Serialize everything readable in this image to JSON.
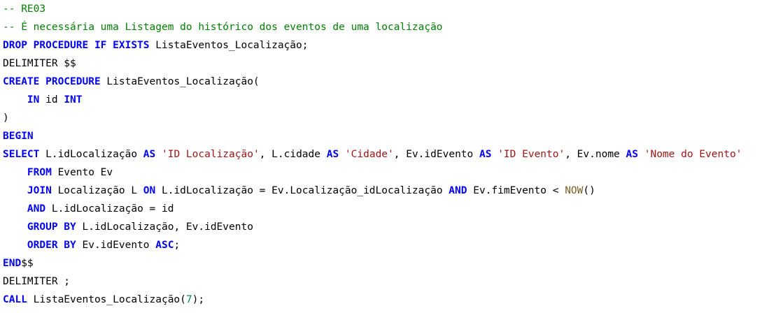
{
  "colors": {
    "background": "#ffffff",
    "keyword": "#0000ff",
    "comment": "#008000",
    "string": "#a31515",
    "number": "#098658",
    "function": "#795e26",
    "text": "#000000"
  },
  "lines": [
    [
      {
        "t": "comment",
        "v": "-- RE03"
      }
    ],
    [
      {
        "t": "comment",
        "v": "-- É necessária uma Listagem do histórico dos eventos de uma localização"
      }
    ],
    [
      {
        "t": "kw",
        "v": "DROP PROCEDURE IF EXISTS"
      },
      {
        "t": "text",
        "v": " ListaEventos_Localização;"
      }
    ],
    [
      {
        "t": "text",
        "v": "DELIMITER $$"
      }
    ],
    [
      {
        "t": "kw",
        "v": "CREATE PROCEDURE"
      },
      {
        "t": "text",
        "v": " ListaEventos_Localização("
      }
    ],
    [
      {
        "t": "text",
        "v": "    "
      },
      {
        "t": "kw",
        "v": "IN"
      },
      {
        "t": "text",
        "v": " id "
      },
      {
        "t": "kw",
        "v": "INT"
      }
    ],
    [
      {
        "t": "text",
        "v": ")"
      }
    ],
    [
      {
        "t": "kw",
        "v": "BEGIN"
      }
    ],
    [
      {
        "t": "kw",
        "v": "SELECT"
      },
      {
        "t": "text",
        "v": " L.idLocalização "
      },
      {
        "t": "kw",
        "v": "AS"
      },
      {
        "t": "text",
        "v": " "
      },
      {
        "t": "str",
        "v": "'ID Localização'"
      },
      {
        "t": "text",
        "v": ", L.cidade "
      },
      {
        "t": "kw",
        "v": "AS"
      },
      {
        "t": "text",
        "v": " "
      },
      {
        "t": "str",
        "v": "'Cidade'"
      },
      {
        "t": "text",
        "v": ", Ev.idEvento "
      },
      {
        "t": "kw",
        "v": "AS"
      },
      {
        "t": "text",
        "v": " "
      },
      {
        "t": "str",
        "v": "'ID Evento'"
      },
      {
        "t": "text",
        "v": ", Ev.nome "
      },
      {
        "t": "kw",
        "v": "AS"
      },
      {
        "t": "text",
        "v": " "
      },
      {
        "t": "str",
        "v": "'Nome do Evento'"
      }
    ],
    [
      {
        "t": "text",
        "v": "    "
      },
      {
        "t": "kw",
        "v": "FROM"
      },
      {
        "t": "text",
        "v": " Evento Ev"
      }
    ],
    [
      {
        "t": "text",
        "v": "    "
      },
      {
        "t": "kw",
        "v": "JOIN"
      },
      {
        "t": "text",
        "v": " Localização L "
      },
      {
        "t": "kw",
        "v": "ON"
      },
      {
        "t": "text",
        "v": " L.idLocalização = Ev.Localização_idLocalização "
      },
      {
        "t": "kw",
        "v": "AND"
      },
      {
        "t": "text",
        "v": " Ev.fimEvento < "
      },
      {
        "t": "fn",
        "v": "NOW"
      },
      {
        "t": "text",
        "v": "()"
      }
    ],
    [
      {
        "t": "text",
        "v": "    "
      },
      {
        "t": "kw",
        "v": "AND"
      },
      {
        "t": "text",
        "v": " L.idLocalização = id"
      }
    ],
    [
      {
        "t": "text",
        "v": "    "
      },
      {
        "t": "kw",
        "v": "GROUP BY"
      },
      {
        "t": "text",
        "v": " L.idLocalização, Ev.idEvento"
      }
    ],
    [
      {
        "t": "text",
        "v": "    "
      },
      {
        "t": "kw",
        "v": "ORDER BY"
      },
      {
        "t": "text",
        "v": " Ev.idEvento "
      },
      {
        "t": "kw",
        "v": "ASC"
      },
      {
        "t": "text",
        "v": ";"
      }
    ],
    [
      {
        "t": "kw",
        "v": "END"
      },
      {
        "t": "text",
        "v": "$$"
      }
    ],
    [
      {
        "t": "text",
        "v": "DELIMITER ;"
      }
    ],
    [
      {
        "t": "kw",
        "v": "CALL"
      },
      {
        "t": "text",
        "v": " ListaEventos_Localização("
      },
      {
        "t": "num",
        "v": "7"
      },
      {
        "t": "text",
        "v": ");"
      }
    ]
  ]
}
